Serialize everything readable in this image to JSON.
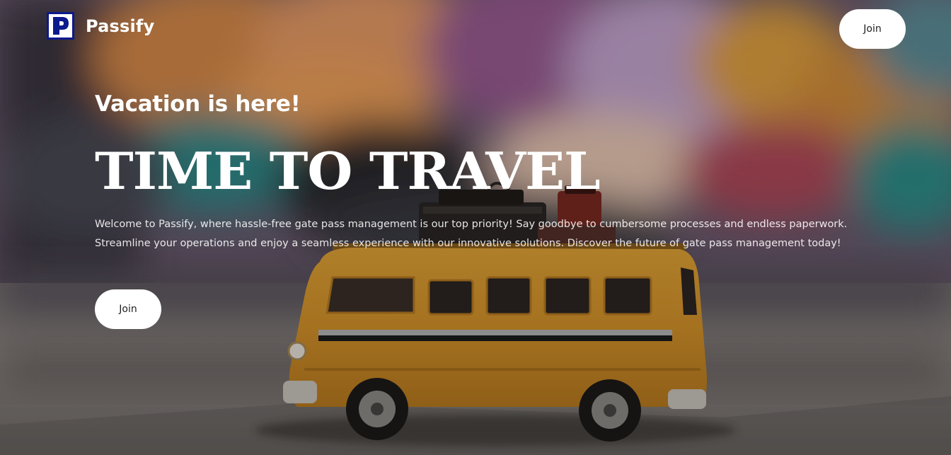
{
  "nav": {
    "brand": "Passify",
    "logo_letter": "P",
    "join_label": "Join"
  },
  "hero": {
    "subtitle": "Vacation is here!",
    "title": "TIME TO TRAVEL",
    "description": "Welcome to Passify, where hassle-free gate pass management is our top priority! Say goodbye to cumbersome processes and endless paperwork. Streamline your operations and enjoy a seamless experience with our innovative solutions. Discover the future of gate pass management today!",
    "join_label": "Join",
    "background_image": "toy-yellow-bus-with-luggage"
  },
  "colors": {
    "logo_blue": "#0b1a8c",
    "button_bg": "#ffffff",
    "text": "#ffffff"
  }
}
